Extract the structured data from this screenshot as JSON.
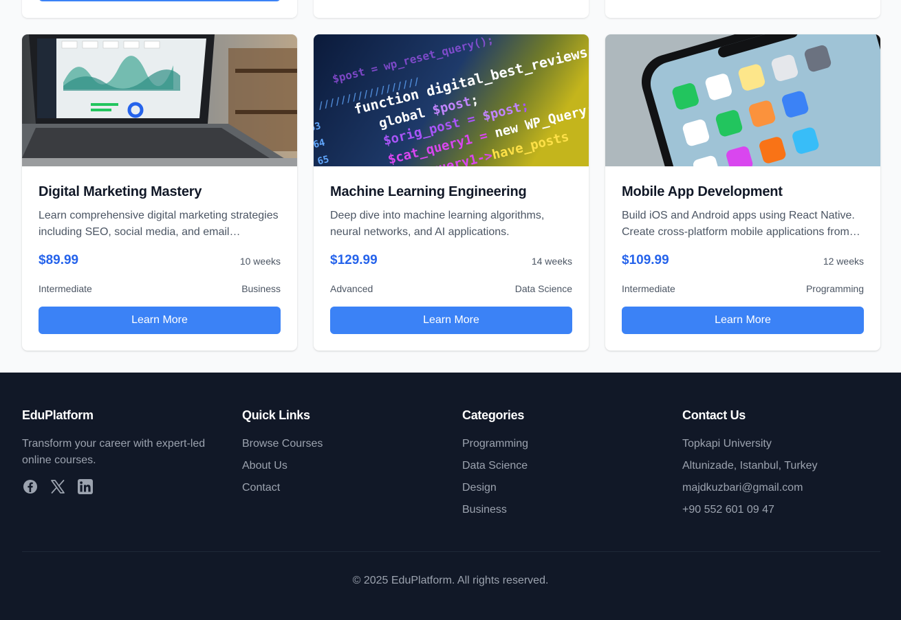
{
  "courses": [
    {
      "title": "Digital Marketing Mastery",
      "description": "Learn comprehensive digital marketing strategies including SEO, social media, and email marketing to grow any business online.",
      "price": "$89.99",
      "duration": "10 weeks",
      "level": "Intermediate",
      "category": "Business",
      "button_label": "Learn More",
      "image_icon": "laptop-analytics-dashboard-photo"
    },
    {
      "title": "Machine Learning Engineering",
      "description": "Deep dive into machine learning algorithms, neural networks, and AI applications.",
      "price": "$129.99",
      "duration": "14 weeks",
      "level": "Advanced",
      "category": "Data Science",
      "button_label": "Learn More",
      "image_icon": "source-code-screen-photo"
    },
    {
      "title": "Mobile App Development",
      "description": "Build iOS and Android apps using React Native. Create cross-platform mobile applications from scratch.",
      "price": "$109.99",
      "duration": "12 weeks",
      "level": "Intermediate",
      "category": "Programming",
      "button_label": "Learn More",
      "image_icon": "smartphone-home-screen-photo"
    }
  ],
  "footer": {
    "brand": {
      "title": "EduPlatform",
      "tagline": "Transform your career with expert-led online courses.",
      "socials": [
        "facebook-icon",
        "x-twitter-icon",
        "linkedin-icon"
      ]
    },
    "quick_links": {
      "title": "Quick Links",
      "items": [
        "Browse Courses",
        "About Us",
        "Contact"
      ]
    },
    "categories": {
      "title": "Categories",
      "items": [
        "Programming",
        "Data Science",
        "Design",
        "Business"
      ]
    },
    "contact": {
      "title": "Contact Us",
      "items": [
        "Topkapi University",
        "Altunizade, Istanbul, Turkey",
        "majdkuzbari@gmail.com",
        "+90 552 601 09 47"
      ]
    },
    "copyright": "© 2025 EduPlatform. All rights reserved."
  },
  "colors": {
    "accent": "#3b82f6",
    "price": "#2563eb",
    "footer_bg": "#111827",
    "page_bg": "#f9fafb"
  }
}
